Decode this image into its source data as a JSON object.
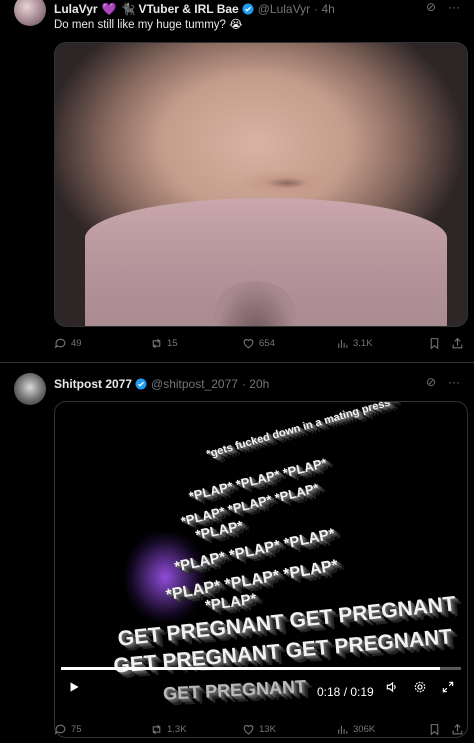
{
  "posts": [
    {
      "name": "LulaVyr",
      "name_suffix": "VTuber & IRL Bae",
      "handle": "@LulaVyr",
      "time": "· 4h",
      "text": "Do men still like my huge tummy? 😭",
      "emoji_1": "💜",
      "emoji_2": "🐈‍⬛",
      "stats": {
        "replies": "49",
        "reposts": "15",
        "likes": "654",
        "views": "3.1K"
      }
    },
    {
      "name": "Shitpost 2077",
      "handle": "@shitpost_2077",
      "time": "· 20h",
      "video": {
        "lines": [
          "*gets fucked down in a mating press*",
          "*PLAP* *PLAP* *PLAP*",
          "*PLAP* *PLAP* *PLAP*",
          "*PLAP*",
          "*PLAP* *PLAP* *PLAP*",
          "*PLAP* *PLAP* *PLAP*",
          "*PLAP*",
          "GET PREGNANT GET PREGNANT",
          "GET PREGNANT GET PREGNANT",
          "GET PREGNANT"
        ],
        "time": "0:18 / 0:19",
        "progress": 0.947
      },
      "stats": {
        "replies": "75",
        "reposts": "1.3K",
        "likes": "13K",
        "views": "306K"
      }
    }
  ],
  "colors": {
    "accent": "#1d9bf0",
    "muted": "#71767b",
    "text": "#e7e9ea",
    "background": "#000000"
  },
  "icons": [
    "verified-badge-icon",
    "grok-icon",
    "more-icon",
    "reply-icon",
    "repost-icon",
    "like-icon",
    "views-icon",
    "bookmark-icon",
    "share-icon",
    "play-icon",
    "volume-icon",
    "settings-icon",
    "fullscreen-icon"
  ]
}
